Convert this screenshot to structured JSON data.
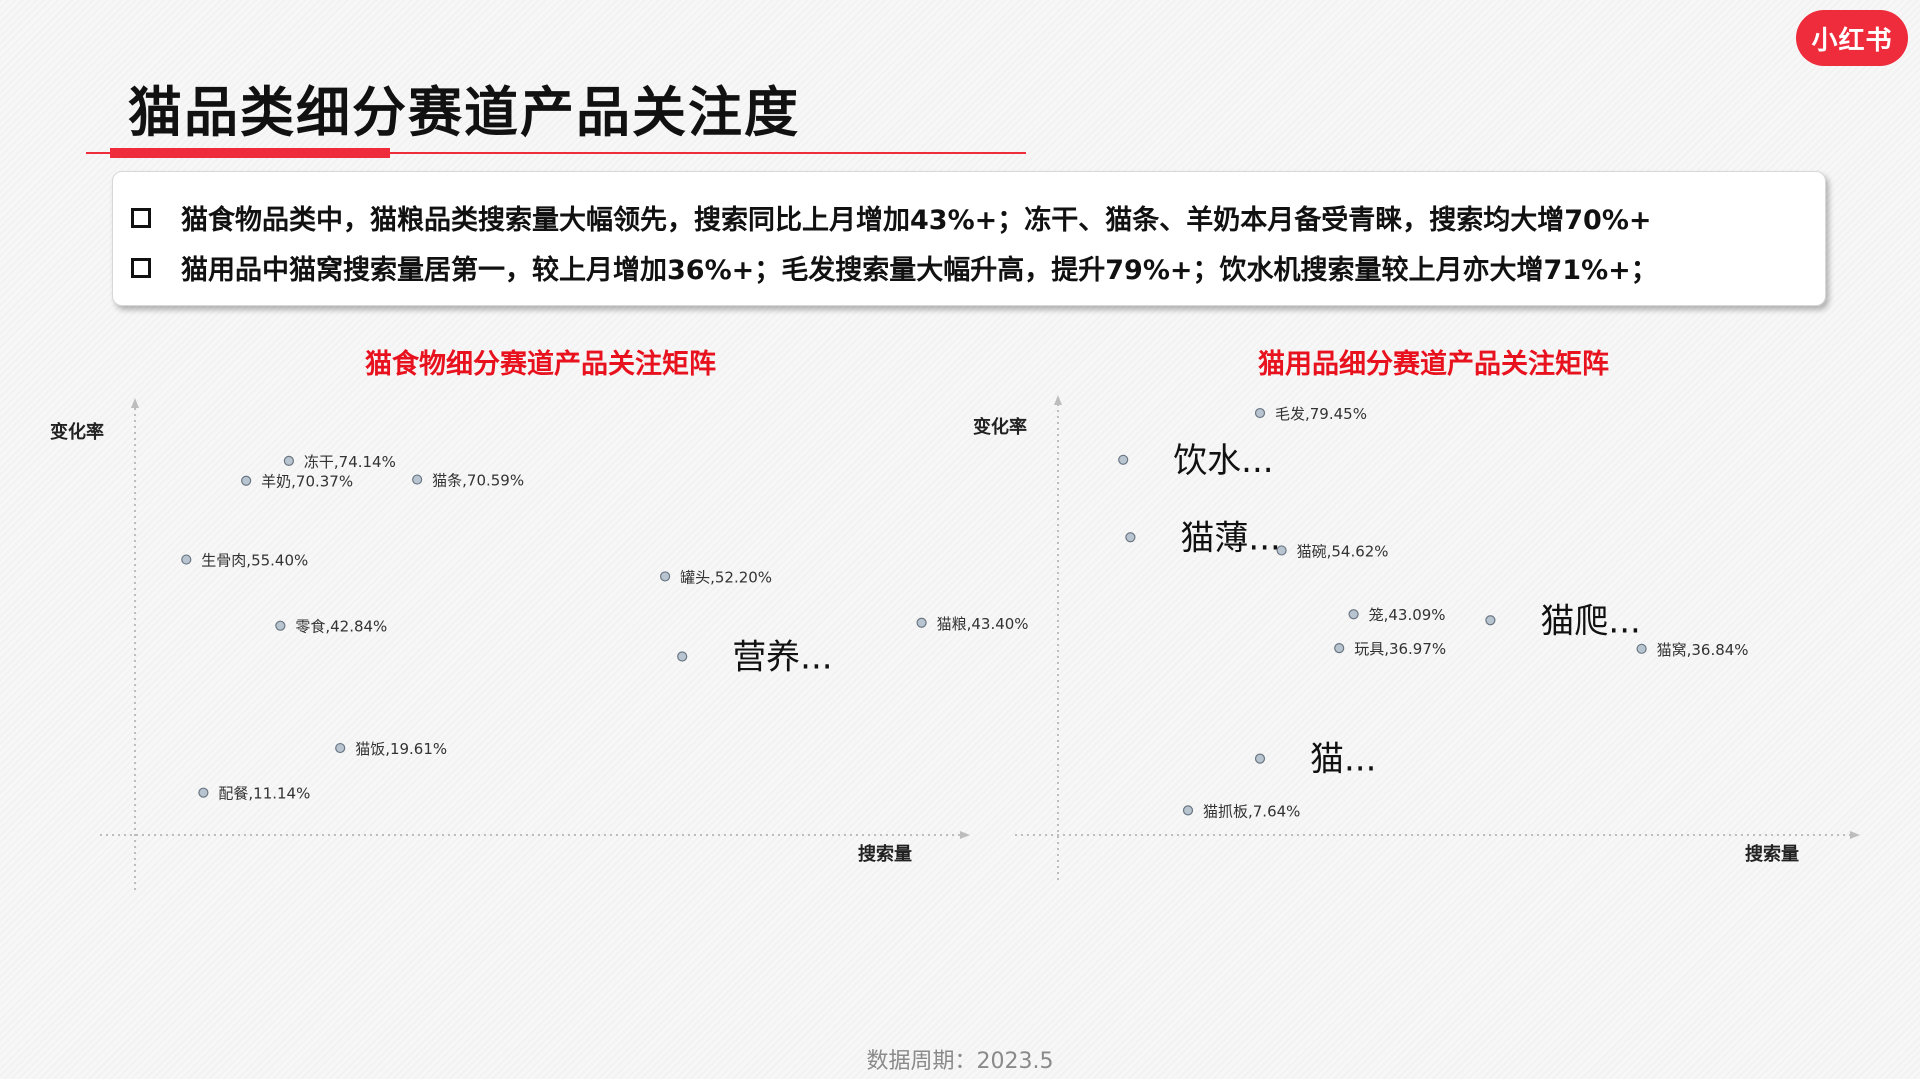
{
  "logo": {
    "text": "小红书"
  },
  "page_title": "猫品类细分赛道产品关注度",
  "summary": [
    "猫食物品类中，猫粮品类搜索量大幅领先，搜索同比上月增加43%+；冻干、猫条、羊奶本月备受青睐，搜索均大增70%+",
    "猫用品中猫窝搜索量居第一，较上月增加36%+；毛发搜索量大幅升高，提升79%+；饮水机搜索量较上月亦大增71%+；"
  ],
  "footer": "数据周期：2023.5",
  "colors": {
    "accent": "#ee2c3c",
    "chart_title": "#e8121f",
    "marker_fill": "#b8c4d0",
    "marker_stroke": "#6b7683"
  },
  "chart_data": [
    {
      "type": "scatter",
      "title": "猫食物细分赛道产品关注矩阵",
      "xlabel": "搜索量",
      "ylabel": "变化率",
      "points": [
        {
          "label": "冻干,74.14%",
          "x": 0.18,
          "y": 74.14
        },
        {
          "label": "羊奶,70.37%",
          "x": 0.13,
          "y": 70.37
        },
        {
          "label": "猫条,70.59%",
          "x": 0.33,
          "y": 70.59
        },
        {
          "label": "生骨肉,55.40%",
          "x": 0.06,
          "y": 55.4
        },
        {
          "label": "罐头,52.20%",
          "x": 0.62,
          "y": 52.2
        },
        {
          "label": "猫粮,43.40%",
          "x": 0.92,
          "y": 43.4
        },
        {
          "label": "零食,42.84%",
          "x": 0.17,
          "y": 42.84
        },
        {
          "label": "营养...",
          "x": 0.64,
          "y": 37.0,
          "big": true
        },
        {
          "label": "猫饭,19.61%",
          "x": 0.24,
          "y": 19.61
        },
        {
          "label": "配餐,11.14%",
          "x": 0.08,
          "y": 11.14
        }
      ]
    },
    {
      "type": "scatter",
      "title": "猫用品细分赛道产品关注矩阵",
      "xlabel": "搜索量",
      "ylabel": "变化率",
      "points": [
        {
          "label": "毛发,79.45%",
          "x": 0.25,
          "y": 79.45
        },
        {
          "label": "饮水...",
          "x": 0.06,
          "y": 71.0,
          "big": true
        },
        {
          "label": "猫薄...",
          "x": 0.07,
          "y": 57.0,
          "big": true
        },
        {
          "label": "猫碗,54.62%",
          "x": 0.28,
          "y": 54.62
        },
        {
          "label": "笼,43.09%",
          "x": 0.38,
          "y": 43.09
        },
        {
          "label": "猫爬...",
          "x": 0.57,
          "y": 42.0,
          "big": true
        },
        {
          "label": "玩具,36.97%",
          "x": 0.36,
          "y": 36.97
        },
        {
          "label": "猫窝,36.84%",
          "x": 0.78,
          "y": 36.84
        },
        {
          "label": "猫...",
          "x": 0.25,
          "y": 17.0,
          "big": true
        },
        {
          "label": "猫抓板,7.64%",
          "x": 0.15,
          "y": 7.64
        }
      ]
    }
  ]
}
